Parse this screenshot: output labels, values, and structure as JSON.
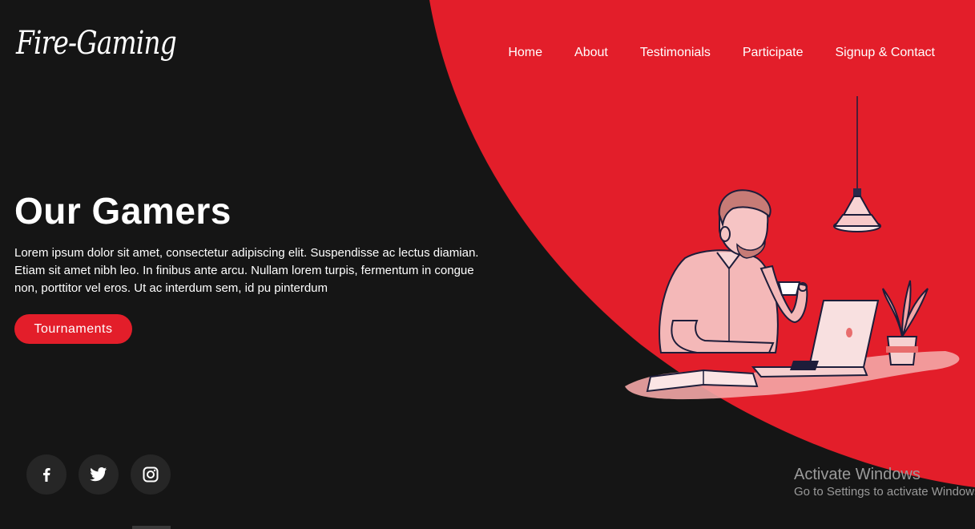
{
  "brand": {
    "logo_text": "Fire-Gaming"
  },
  "nav": {
    "items": [
      {
        "label": "Home"
      },
      {
        "label": "About"
      },
      {
        "label": "Testimonials"
      },
      {
        "label": "Participate"
      },
      {
        "label": "Signup & Contact"
      }
    ]
  },
  "hero": {
    "title": "Our Gamers",
    "body": "Lorem ipsum dolor sit amet, consectetur adipiscing elit. Suspendisse ac lectus diamian. Etiam sit amet nibh leo. In finibus ante arcu. Nullam lorem turpis, fermentum in congue non, porttitor vel eros. Ut ac interdum sem, id pu pinterdum",
    "cta_label": "Tournaments"
  },
  "social": {
    "icons": [
      "facebook-icon",
      "twitter-icon",
      "instagram-icon"
    ]
  },
  "watermark": {
    "title": "Activate Windows",
    "subtitle": "Go to Settings to activate Windows."
  },
  "colors": {
    "background": "#151515",
    "accent": "#e31e2a",
    "text": "#ffffff",
    "social_bg": "#262626"
  }
}
